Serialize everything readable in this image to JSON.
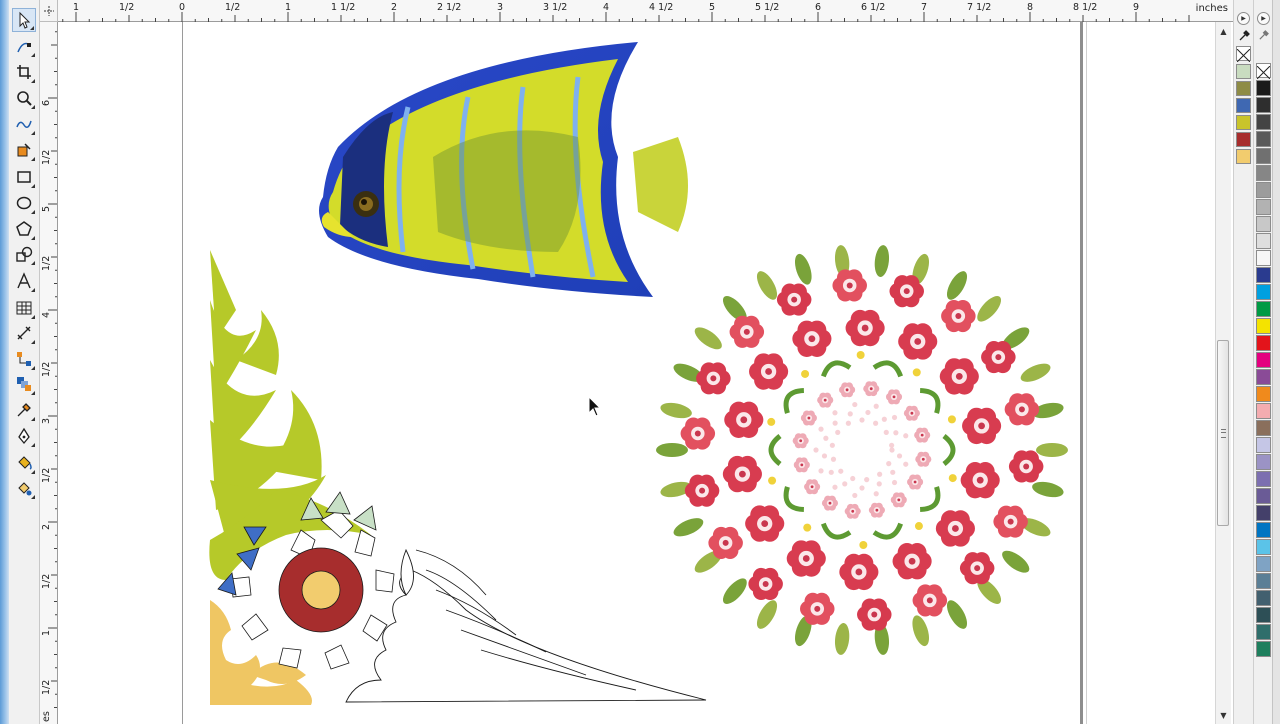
{
  "app": {
    "name": "vector drawing editor"
  },
  "toolbox": {
    "tools": [
      {
        "name": "pick-tool",
        "icon": "arrow-pointer-icon",
        "active": true
      },
      {
        "name": "shape-tool",
        "icon": "shape-node-icon"
      },
      {
        "name": "crop-tool",
        "icon": "crop-icon"
      },
      {
        "name": "zoom-tool",
        "icon": "magnifier-icon"
      },
      {
        "name": "freehand-tool",
        "icon": "freehand-curve-icon"
      },
      {
        "name": "smart-fill-tool",
        "icon": "smart-fill-icon"
      },
      {
        "name": "rectangle-tool",
        "icon": "rectangle-icon"
      },
      {
        "name": "ellipse-tool",
        "icon": "ellipse-icon"
      },
      {
        "name": "polygon-tool",
        "icon": "polygon-icon"
      },
      {
        "name": "basic-shapes-tool",
        "icon": "basic-shapes-icon"
      },
      {
        "name": "text-tool",
        "icon": "text-a-icon"
      },
      {
        "name": "table-tool",
        "icon": "table-grid-icon"
      },
      {
        "name": "dimension-tool",
        "icon": "dimension-icon"
      },
      {
        "name": "connector-tool",
        "icon": "connector-icon"
      },
      {
        "name": "effects-tool",
        "icon": "blend-effects-icon"
      },
      {
        "name": "eyedropper-tool",
        "icon": "eyedropper-icon"
      },
      {
        "name": "outline-pen-tool",
        "icon": "pen-nib-icon"
      },
      {
        "name": "fill-tool",
        "icon": "paint-bucket-icon"
      },
      {
        "name": "interactive-fill-tool",
        "icon": "interactive-fill-icon"
      }
    ]
  },
  "rulers": {
    "units": "inches",
    "horizontal": [
      "1",
      "1/2",
      "0",
      "1/2",
      "1",
      "1 1/2",
      "2",
      "2 1/2",
      "3",
      "3 1/2",
      "4",
      "4 1/2",
      "5",
      "5 1/2",
      "6",
      "6 1/2",
      "7",
      "7 1/2",
      "8",
      "8 1/2",
      "9"
    ],
    "vertical": [
      "6",
      "1/2",
      "5",
      "1/2",
      "4",
      "1/2",
      "3",
      "1/2",
      "2",
      "1/2",
      "1",
      "1/2"
    ],
    "vertical_units_partial": "es"
  },
  "canvas": {
    "objects": [
      {
        "name": "angelfish-image",
        "description": "photo"
      },
      {
        "name": "corner-ornament",
        "description": "vector"
      },
      {
        "name": "floral-wreath",
        "description": "vector"
      }
    ]
  },
  "document_palette": {
    "colors": [
      "#c9dcc0",
      "#8e8c46",
      "#3f68b2",
      "#c9c42b",
      "#a72d2d",
      "#f2cc6e"
    ]
  },
  "color_palette": {
    "colors": [
      "#1a1a1a",
      "#2e2e2e",
      "#444444",
      "#5a5a5a",
      "#707070",
      "#868686",
      "#9c9c9c",
      "#b2b2b2",
      "#c8c8c8",
      "#dedede",
      "#f7f7f7",
      "#2a3b8f",
      "#00a0e0",
      "#009a44",
      "#f4e300",
      "#e3141b",
      "#e4007f",
      "#8a4b97",
      "#f08a1c",
      "#f4acb0",
      "#8a6f5c",
      "#c5c6e6",
      "#9b93c5",
      "#7c6fb0",
      "#6a5b96",
      "#44406a",
      "#0075c2",
      "#5bc3e8",
      "#7fa3c4",
      "#5b7f96",
      "#42606f",
      "#2d4f56",
      "#2f6e6b",
      "#1e7f5d"
    ]
  },
  "scrollbar": {
    "up": "▲",
    "down": "▼"
  }
}
